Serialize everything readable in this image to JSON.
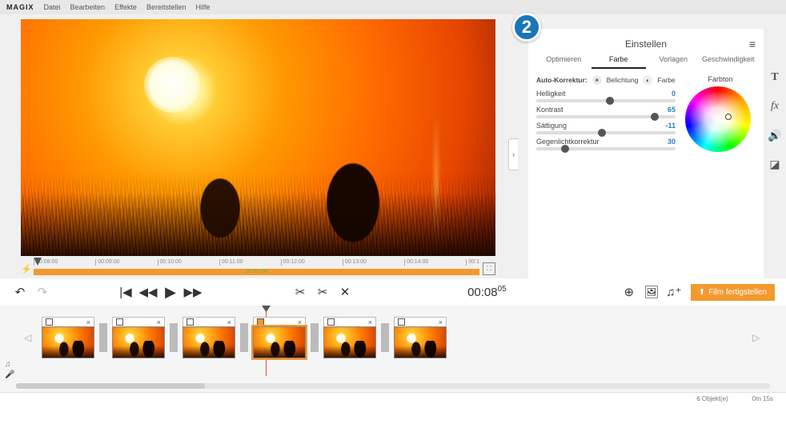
{
  "brand": "MAGIX",
  "menu": [
    "Datei",
    "Bearbeiten",
    "Effekte",
    "Bereitstellen",
    "Hilfe"
  ],
  "badge": "2",
  "ruler": {
    "ticks": [
      "00:08:00",
      "00:09:00",
      "00:10:00",
      "00:11:00",
      "00:12:00",
      "00:13:00",
      "00:14:00",
      "00:1"
    ],
    "label": "00:07:08"
  },
  "panel": {
    "title": "Einstellen",
    "tabs": [
      "Optimieren",
      "Farbe",
      "Vorlagen",
      "Geschwindigkeit"
    ],
    "active_tab": 1,
    "auto_label": "Auto-Korrektur:",
    "auto_opts": [
      "Belichtung",
      "Farbe"
    ],
    "wheel_label": "Farbton",
    "sliders": [
      {
        "name": "Helligkeit",
        "value": "0",
        "pos": 50
      },
      {
        "name": "Kontrast",
        "value": "65",
        "pos": 82
      },
      {
        "name": "Sättigung",
        "value": "-11",
        "pos": 44
      },
      {
        "name": "Gegenlichtkorrektur",
        "value": "30",
        "pos": 18
      }
    ]
  },
  "right_tools": [
    "T",
    "fx",
    "vol",
    "contrast"
  ],
  "controls": {
    "timecode_main": "00:08",
    "timecode_sub": "05",
    "export_label": "Film fertigstellen"
  },
  "timeline": {
    "clips": [
      {
        "selected": false
      },
      {
        "selected": false
      },
      {
        "selected": false
      },
      {
        "selected": true
      },
      {
        "selected": false
      },
      {
        "selected": false
      }
    ]
  },
  "status": {
    "objects": "6 Objekt(e)",
    "duration": "0m 15s"
  }
}
